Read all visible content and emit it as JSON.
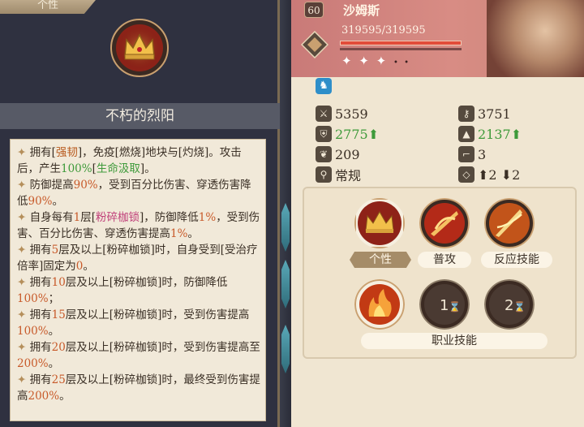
{
  "left_panel": {
    "tab_label": "个性",
    "skill_name": "不朽的烈阳",
    "description": [
      {
        "parts": [
          [
            "✦ ",
            "spark"
          ],
          [
            "拥有[",
            ""
          ],
          [
            "强韧",
            "hl-brown"
          ],
          [
            "]，免疫[燃烧]地块与[灼烧]。攻击后，产生",
            ""
          ],
          [
            "100%",
            "hl-green"
          ],
          [
            "[",
            ""
          ],
          [
            "生命汲取",
            "hl-green"
          ],
          [
            "]。",
            ""
          ]
        ]
      },
      {
        "parts": [
          [
            "✦ ",
            "spark"
          ],
          [
            "防御提高",
            ""
          ],
          [
            "90%",
            "hl-orange"
          ],
          [
            "，受到百分比伤害、穿透伤害降低",
            ""
          ],
          [
            "90%",
            "hl-orange"
          ],
          [
            "。",
            ""
          ]
        ]
      },
      {
        "parts": [
          [
            "✦ ",
            "spark"
          ],
          [
            "自身每有",
            ""
          ],
          [
            "1",
            "hl-orange"
          ],
          [
            "层[",
            ""
          ],
          [
            "粉碎枷锁",
            "hl-pink"
          ],
          [
            "]，防御降低",
            ""
          ],
          [
            "1%",
            "hl-orange"
          ],
          [
            "，受到伤害、百分比伤害、穿透伤害提高",
            ""
          ],
          [
            "1%",
            "hl-orange"
          ],
          [
            "。",
            ""
          ]
        ]
      },
      {
        "parts": [
          [
            "✦ ",
            "spark"
          ],
          [
            "拥有",
            ""
          ],
          [
            "5",
            "hl-orange"
          ],
          [
            "层及以上[粉碎枷锁]时，自身受到[受治疗倍率]固定为",
            ""
          ],
          [
            "0",
            "hl-orange"
          ],
          [
            "。",
            ""
          ]
        ]
      },
      {
        "parts": [
          [
            "✦ ",
            "spark"
          ],
          [
            "拥有",
            ""
          ],
          [
            "10",
            "hl-orange"
          ],
          [
            "层及以上[粉碎枷锁]时，防御降低",
            ""
          ],
          [
            "100%",
            "hl-orange"
          ],
          [
            "；",
            ""
          ]
        ]
      },
      {
        "parts": [
          [
            "✦ ",
            "spark"
          ],
          [
            "拥有",
            ""
          ],
          [
            "15",
            "hl-orange"
          ],
          [
            "层及以上[粉碎枷锁]时，受到伤害提高",
            ""
          ],
          [
            "100%",
            "hl-orange"
          ],
          [
            "。",
            ""
          ]
        ]
      },
      {
        "parts": [
          [
            "✦ ",
            "spark"
          ],
          [
            "拥有",
            ""
          ],
          [
            "20",
            "hl-orange"
          ],
          [
            "层及以上[粉碎枷锁]时，受到伤害提高至",
            ""
          ],
          [
            "200%",
            "hl-orange"
          ],
          [
            "。",
            ""
          ]
        ]
      },
      {
        "parts": [
          [
            "✦ ",
            "spark"
          ],
          [
            "拥有",
            ""
          ],
          [
            "25",
            "hl-orange"
          ],
          [
            "层及以上[粉碎枷锁]时，最终受到伤害提高",
            ""
          ],
          [
            "200%",
            "hl-orange"
          ],
          [
            "。",
            ""
          ]
        ]
      }
    ]
  },
  "character": {
    "level": "60",
    "name": "沙姆斯",
    "hp_text": "319595/319595",
    "hp_fraction": 1.0,
    "stars_filled": "✦ ✦ ✦",
    "stars_empty": "• •"
  },
  "stats": {
    "atk": "5359",
    "mag": "3751",
    "def": "2775",
    "def_up": "⬆",
    "mdef": "2137",
    "mdef_up": "⬆",
    "tech": "209",
    "move": "3",
    "type": "常规",
    "range": "⬆2 ⬇2"
  },
  "skills": {
    "trait_label": "个性",
    "normal_label": "普攻",
    "reaction_label": "反应技能",
    "prof_label": "职业技能",
    "prof_slot_1": "1",
    "prof_slot_2": "2"
  }
}
